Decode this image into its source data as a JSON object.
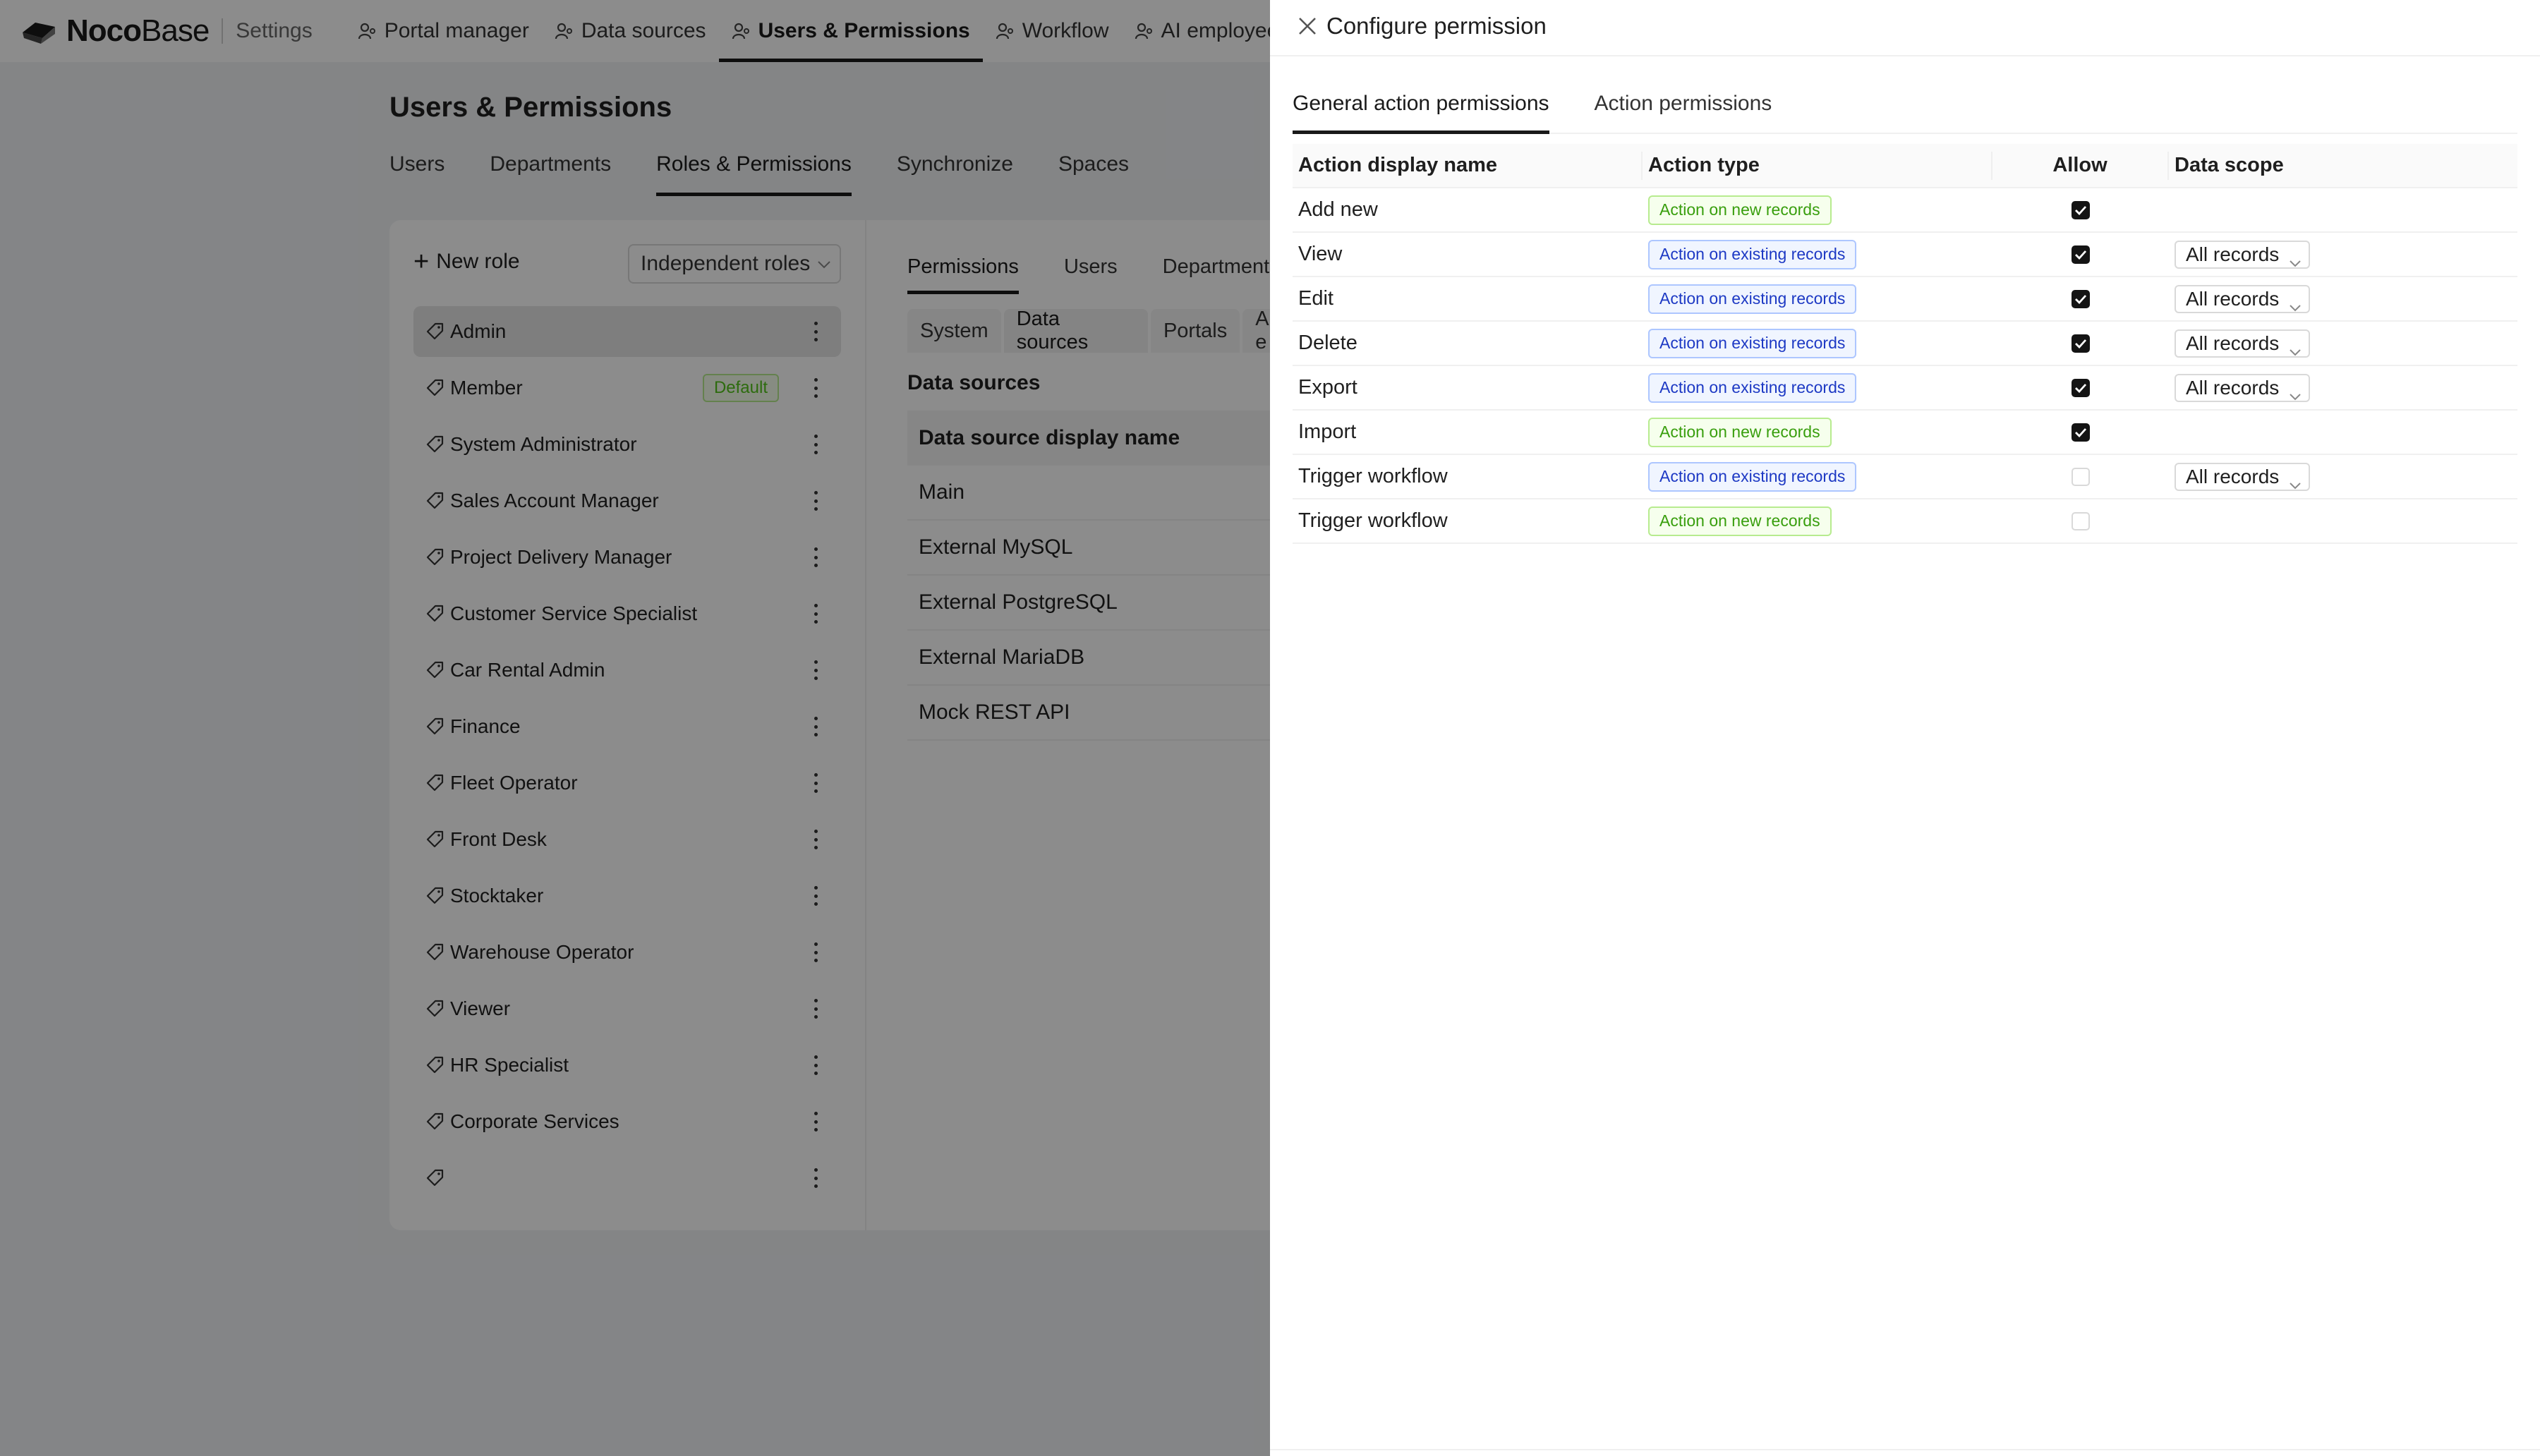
{
  "brand": {
    "name_bold": "Noco",
    "name_light": "Base",
    "section": "Settings"
  },
  "topnav": [
    {
      "label": "Portal manager",
      "icon": "portal-icon"
    },
    {
      "label": "Data sources",
      "icon": "database-icon"
    },
    {
      "label": "Users & Permissions",
      "icon": "users-icon",
      "active": true
    },
    {
      "label": "Workflow",
      "icon": "workflow-icon"
    },
    {
      "label": "AI employees",
      "icon": "ai-icon"
    }
  ],
  "page": {
    "title": "Users & Permissions",
    "tabs": [
      "Users",
      "Departments",
      "Roles & Permissions",
      "Synchronize",
      "Spaces"
    ],
    "active_tab": "Roles & Permissions"
  },
  "roles_panel": {
    "new_role_label": "New role",
    "mode_select": "Independent roles",
    "default_badge": "Default",
    "roles": [
      "Admin",
      "Member",
      "System Administrator",
      "Sales Account Manager",
      "Project Delivery Manager",
      "Customer Service Specialist",
      "Car Rental Admin",
      "Finance",
      "Fleet Operator",
      "Front Desk",
      "Stocktaker",
      "Warehouse Operator",
      "Viewer",
      "HR Specialist",
      "Corporate Services",
      ""
    ],
    "active_role": "Admin"
  },
  "permissions_panel": {
    "tabs": [
      "Permissions",
      "Users",
      "Departments"
    ],
    "source_tabs": [
      "System",
      "Data sources",
      "Portals",
      "AI e"
    ],
    "heading": "Data sources",
    "table_header": "Data source display name",
    "rows": [
      "Main",
      "External MySQL",
      "External PostgreSQL",
      "External MariaDB",
      "Mock REST API"
    ]
  },
  "drawer": {
    "title": "Configure permission",
    "tabs": [
      "General action permissions",
      "Action permissions"
    ],
    "columns": [
      "Action display name",
      "Action type",
      "Allow",
      "Data scope"
    ],
    "rows": [
      {
        "name": "Add new",
        "type": "Action on new records",
        "kind": "new",
        "allow": true,
        "scope": ""
      },
      {
        "name": "View",
        "type": "Action on existing records",
        "kind": "existing",
        "allow": true,
        "scope": "All records"
      },
      {
        "name": "Edit",
        "type": "Action on existing records",
        "kind": "existing",
        "allow": true,
        "scope": "All records"
      },
      {
        "name": "Delete",
        "type": "Action on existing records",
        "kind": "existing",
        "allow": true,
        "scope": "All records"
      },
      {
        "name": "Export",
        "type": "Action on existing records",
        "kind": "existing",
        "allow": true,
        "scope": "All records"
      },
      {
        "name": "Import",
        "type": "Action on new records",
        "kind": "new",
        "allow": true,
        "scope": ""
      },
      {
        "name": "Trigger workflow",
        "type": "Action on existing records",
        "kind": "existing",
        "allow": false,
        "scope": "All records"
      },
      {
        "name": "Trigger workflow",
        "type": "Action on new records",
        "kind": "new",
        "allow": false,
        "scope": ""
      }
    ]
  },
  "colors": {
    "tag_new": "#389e0d",
    "tag_existing": "#1d39c4",
    "mask": "rgba(0,0,0,0.45)"
  }
}
